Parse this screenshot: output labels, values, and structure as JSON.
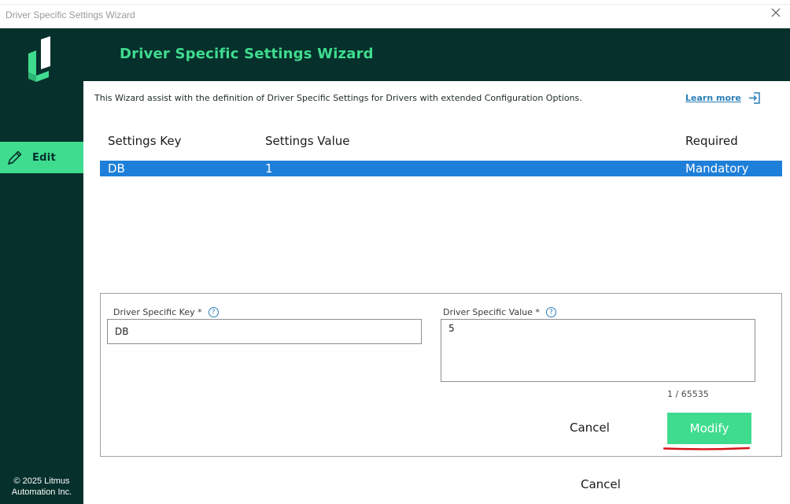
{
  "window": {
    "title": "Driver Specific Settings Wizard"
  },
  "sidebar": {
    "edit_label": "Edit",
    "copyright_line1": "© 2025 Litmus",
    "copyright_line2": "Automation Inc."
  },
  "header": {
    "title": "Driver Specific Settings Wizard"
  },
  "main": {
    "intro": "This Wizard assist with the definition of Driver Specific Settings for Drivers with extended Configuration Options.",
    "learn_more": "Learn more"
  },
  "table": {
    "columns": [
      "Settings Key",
      "Settings Value",
      "Required"
    ],
    "rows": [
      {
        "key": "DB",
        "value": "1",
        "required": "Mandatory"
      }
    ]
  },
  "form": {
    "key_label": "Driver Specific Key *",
    "key_value": "DB",
    "value_label": "Driver Specific Value *",
    "value_value": "5",
    "help_glyph": "?",
    "counter": "1 / 65535",
    "cancel_label": "Cancel",
    "modify_label": "Modify"
  },
  "footer": {
    "cancel_label": "Cancel"
  },
  "colors": {
    "brand_dark": "#06302b",
    "brand_green": "#3fdc8f",
    "selection_blue": "#1e7fd9",
    "link_blue": "#2a7fb8",
    "annotation_red": "#d6151a"
  },
  "icons": {
    "logo": "litmus-logo-icon",
    "edit": "pencil-icon",
    "learn_more": "external-link-icon",
    "close": "close-icon",
    "help": "question-circle-icon"
  }
}
